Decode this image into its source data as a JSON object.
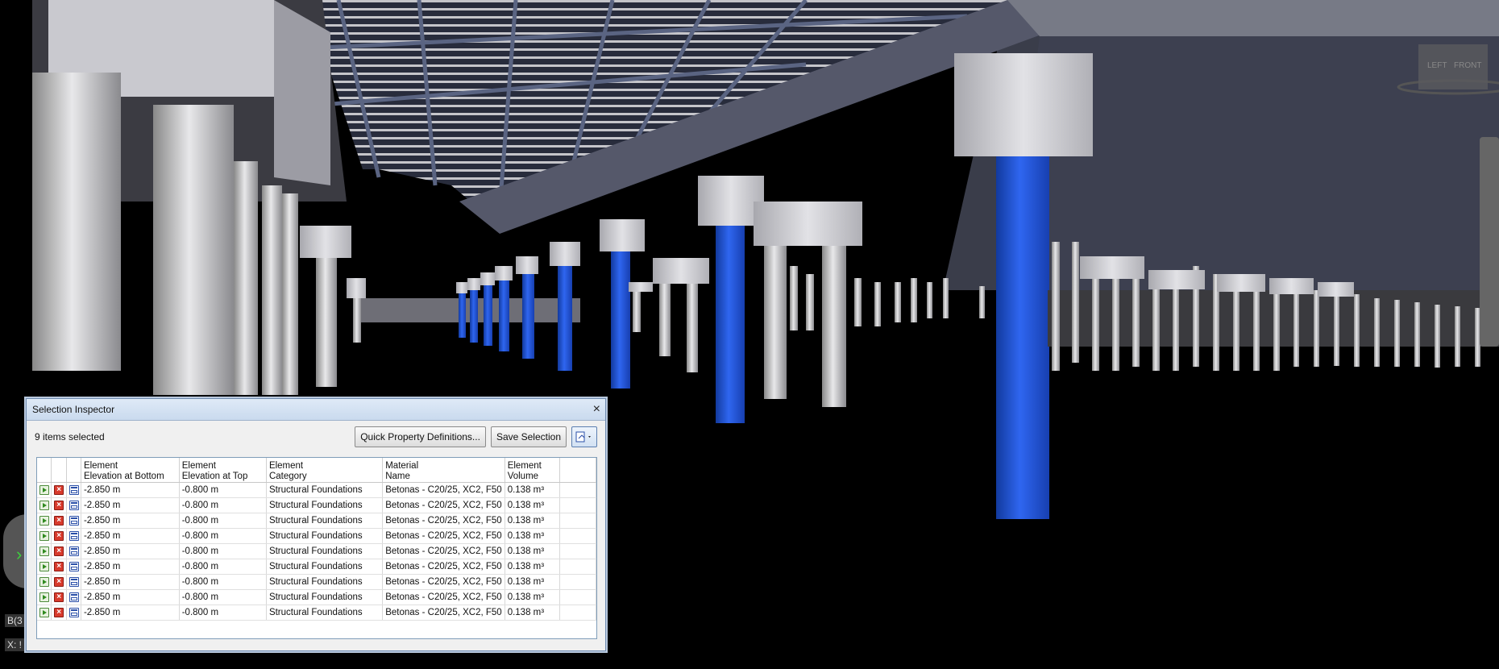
{
  "panel": {
    "title": "Selection Inspector",
    "close_glyph": "×",
    "count_label": "9 items selected",
    "buttons": {
      "quick_property": "Quick Property Definitions...",
      "save_selection": "Save Selection",
      "options_icon": "selection-options-icon"
    },
    "columns": [
      [
        "Element",
        "Elevation at Bottom"
      ],
      [
        "Element",
        "Elevation at Top"
      ],
      [
        "Element",
        "Category"
      ],
      [
        "Material",
        "Name"
      ],
      [
        "Element",
        "Volume"
      ]
    ],
    "rows": [
      [
        "-2.850 m",
        "-0.800 m",
        "Structural Foundations",
        "Betonas - C20/25, XC2, F50",
        "0.138 m³"
      ],
      [
        "-2.850 m",
        "-0.800 m",
        "Structural Foundations",
        "Betonas - C20/25, XC2, F50",
        "0.138 m³"
      ],
      [
        "-2.850 m",
        "-0.800 m",
        "Structural Foundations",
        "Betonas - C20/25, XC2, F50",
        "0.138 m³"
      ],
      [
        "-2.850 m",
        "-0.800 m",
        "Structural Foundations",
        "Betonas - C20/25, XC2, F50",
        "0.138 m³"
      ],
      [
        "-2.850 m",
        "-0.800 m",
        "Structural Foundations",
        "Betonas - C20/25, XC2, F50",
        "0.138 m³"
      ],
      [
        "-2.850 m",
        "-0.800 m",
        "Structural Foundations",
        "Betonas - C20/25, XC2, F50",
        "0.138 m³"
      ],
      [
        "-2.850 m",
        "-0.800 m",
        "Structural Foundations",
        "Betonas - C20/25, XC2, F50",
        "0.138 m³"
      ],
      [
        "-2.850 m",
        "-0.800 m",
        "Structural Foundations",
        "Betonas - C20/25, XC2, F50",
        "0.138 m³"
      ],
      [
        "-2.850 m",
        "-0.800 m",
        "Structural Foundations",
        "Betonas - C20/25, XC2, F50",
        "0.138 m³"
      ]
    ]
  },
  "viewport": {
    "status_1": "B(3",
    "status_2": "X: !",
    "viewcube_left": "LEFT",
    "viewcube_front": "FRONT"
  },
  "colors": {
    "selected_pile": "#1f4fd8",
    "concrete": "#c8c8cc",
    "slab": "#3a3d4a",
    "panel_bg": "#f0f0f0"
  }
}
